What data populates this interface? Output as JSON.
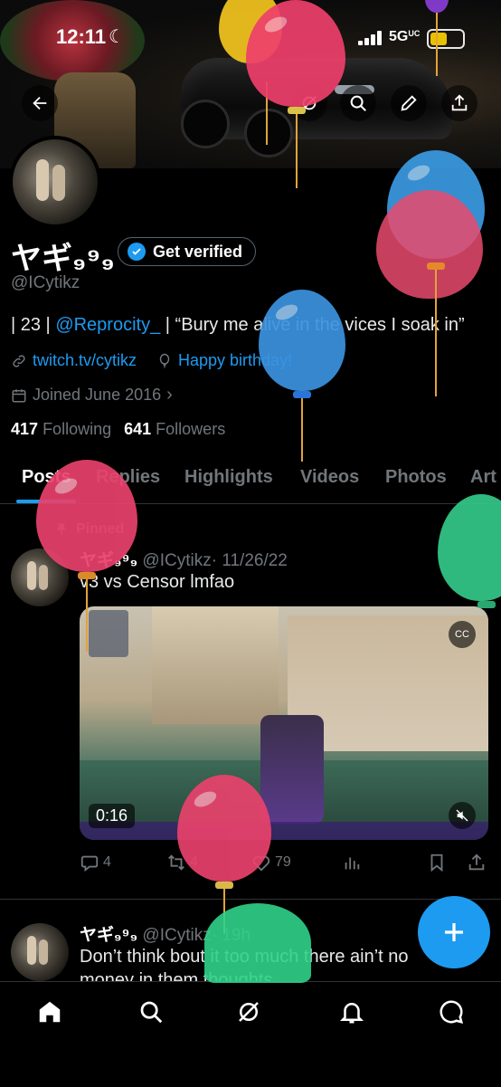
{
  "status_bar": {
    "time": "12:11",
    "network": "5G",
    "network_suffix": "UC"
  },
  "profile": {
    "display_name": "ヤギ₉⁹₉",
    "verify_label": "Get verified",
    "handle": "@ICytikz",
    "bio_prefix": "| 23 | ",
    "bio_mention": "@Reprocity_",
    "bio_suffix": " | “Bury me alive in the vices I soak in”",
    "website": "twitch.tv/cytikz",
    "birthday": "Happy birthday!",
    "joined": "Joined June 2016",
    "following_count": "417",
    "following_label": "Following",
    "followers_count": "641",
    "followers_label": "Followers"
  },
  "tabs": [
    "Posts",
    "Replies",
    "Highlights",
    "Videos",
    "Photos",
    "Art"
  ],
  "posts": [
    {
      "pinned_label": "Pinned",
      "name": "ヤギ₉⁹₉",
      "handle": "@ICytikz",
      "date": "· 11/26/22",
      "text": "v3 vs Censor lmfao",
      "video_duration": "0:16",
      "cc_label": "CC",
      "replies": "4",
      "reposts": "4",
      "likes": "79"
    },
    {
      "name": "ヤギ₉⁹₉",
      "handle": "@ICytikz",
      "date": "· 19h",
      "text": "Don’t think bout it too much there ain’t no",
      "text2": "money in them thoughts"
    }
  ],
  "colors": {
    "accent": "#1d9bf0",
    "muted": "#71767b",
    "background": "#000000"
  },
  "icons": [
    "back-arrow-icon",
    "search-icon",
    "edit-icon",
    "share-icon",
    "verified-badge-icon",
    "link-icon",
    "balloon-icon",
    "calendar-icon",
    "pin-icon",
    "home-icon",
    "grok-icon",
    "bell-icon",
    "messages-icon",
    "plus-icon"
  ]
}
